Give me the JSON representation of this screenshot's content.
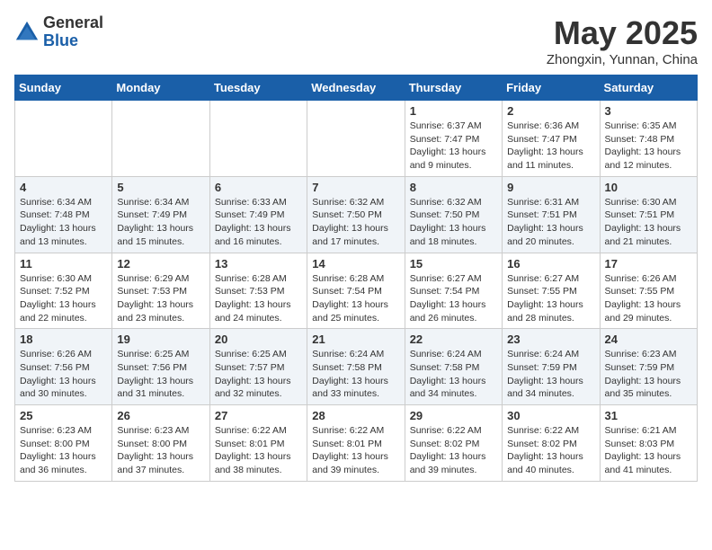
{
  "logo": {
    "general": "General",
    "blue": "Blue"
  },
  "title": "May 2025",
  "location": "Zhongxin, Yunnan, China",
  "days_of_week": [
    "Sunday",
    "Monday",
    "Tuesday",
    "Wednesday",
    "Thursday",
    "Friday",
    "Saturday"
  ],
  "weeks": [
    [
      {
        "day": "",
        "info": ""
      },
      {
        "day": "",
        "info": ""
      },
      {
        "day": "",
        "info": ""
      },
      {
        "day": "",
        "info": ""
      },
      {
        "day": "1",
        "info": "Sunrise: 6:37 AM\nSunset: 7:47 PM\nDaylight: 13 hours\nand 9 minutes."
      },
      {
        "day": "2",
        "info": "Sunrise: 6:36 AM\nSunset: 7:47 PM\nDaylight: 13 hours\nand 11 minutes."
      },
      {
        "day": "3",
        "info": "Sunrise: 6:35 AM\nSunset: 7:48 PM\nDaylight: 13 hours\nand 12 minutes."
      }
    ],
    [
      {
        "day": "4",
        "info": "Sunrise: 6:34 AM\nSunset: 7:48 PM\nDaylight: 13 hours\nand 13 minutes."
      },
      {
        "day": "5",
        "info": "Sunrise: 6:34 AM\nSunset: 7:49 PM\nDaylight: 13 hours\nand 15 minutes."
      },
      {
        "day": "6",
        "info": "Sunrise: 6:33 AM\nSunset: 7:49 PM\nDaylight: 13 hours\nand 16 minutes."
      },
      {
        "day": "7",
        "info": "Sunrise: 6:32 AM\nSunset: 7:50 PM\nDaylight: 13 hours\nand 17 minutes."
      },
      {
        "day": "8",
        "info": "Sunrise: 6:32 AM\nSunset: 7:50 PM\nDaylight: 13 hours\nand 18 minutes."
      },
      {
        "day": "9",
        "info": "Sunrise: 6:31 AM\nSunset: 7:51 PM\nDaylight: 13 hours\nand 20 minutes."
      },
      {
        "day": "10",
        "info": "Sunrise: 6:30 AM\nSunset: 7:51 PM\nDaylight: 13 hours\nand 21 minutes."
      }
    ],
    [
      {
        "day": "11",
        "info": "Sunrise: 6:30 AM\nSunset: 7:52 PM\nDaylight: 13 hours\nand 22 minutes."
      },
      {
        "day": "12",
        "info": "Sunrise: 6:29 AM\nSunset: 7:53 PM\nDaylight: 13 hours\nand 23 minutes."
      },
      {
        "day": "13",
        "info": "Sunrise: 6:28 AM\nSunset: 7:53 PM\nDaylight: 13 hours\nand 24 minutes."
      },
      {
        "day": "14",
        "info": "Sunrise: 6:28 AM\nSunset: 7:54 PM\nDaylight: 13 hours\nand 25 minutes."
      },
      {
        "day": "15",
        "info": "Sunrise: 6:27 AM\nSunset: 7:54 PM\nDaylight: 13 hours\nand 26 minutes."
      },
      {
        "day": "16",
        "info": "Sunrise: 6:27 AM\nSunset: 7:55 PM\nDaylight: 13 hours\nand 28 minutes."
      },
      {
        "day": "17",
        "info": "Sunrise: 6:26 AM\nSunset: 7:55 PM\nDaylight: 13 hours\nand 29 minutes."
      }
    ],
    [
      {
        "day": "18",
        "info": "Sunrise: 6:26 AM\nSunset: 7:56 PM\nDaylight: 13 hours\nand 30 minutes."
      },
      {
        "day": "19",
        "info": "Sunrise: 6:25 AM\nSunset: 7:56 PM\nDaylight: 13 hours\nand 31 minutes."
      },
      {
        "day": "20",
        "info": "Sunrise: 6:25 AM\nSunset: 7:57 PM\nDaylight: 13 hours\nand 32 minutes."
      },
      {
        "day": "21",
        "info": "Sunrise: 6:24 AM\nSunset: 7:58 PM\nDaylight: 13 hours\nand 33 minutes."
      },
      {
        "day": "22",
        "info": "Sunrise: 6:24 AM\nSunset: 7:58 PM\nDaylight: 13 hours\nand 34 minutes."
      },
      {
        "day": "23",
        "info": "Sunrise: 6:24 AM\nSunset: 7:59 PM\nDaylight: 13 hours\nand 34 minutes."
      },
      {
        "day": "24",
        "info": "Sunrise: 6:23 AM\nSunset: 7:59 PM\nDaylight: 13 hours\nand 35 minutes."
      }
    ],
    [
      {
        "day": "25",
        "info": "Sunrise: 6:23 AM\nSunset: 8:00 PM\nDaylight: 13 hours\nand 36 minutes."
      },
      {
        "day": "26",
        "info": "Sunrise: 6:23 AM\nSunset: 8:00 PM\nDaylight: 13 hours\nand 37 minutes."
      },
      {
        "day": "27",
        "info": "Sunrise: 6:22 AM\nSunset: 8:01 PM\nDaylight: 13 hours\nand 38 minutes."
      },
      {
        "day": "28",
        "info": "Sunrise: 6:22 AM\nSunset: 8:01 PM\nDaylight: 13 hours\nand 39 minutes."
      },
      {
        "day": "29",
        "info": "Sunrise: 6:22 AM\nSunset: 8:02 PM\nDaylight: 13 hours\nand 39 minutes."
      },
      {
        "day": "30",
        "info": "Sunrise: 6:22 AM\nSunset: 8:02 PM\nDaylight: 13 hours\nand 40 minutes."
      },
      {
        "day": "31",
        "info": "Sunrise: 6:21 AM\nSunset: 8:03 PM\nDaylight: 13 hours\nand 41 minutes."
      }
    ]
  ]
}
